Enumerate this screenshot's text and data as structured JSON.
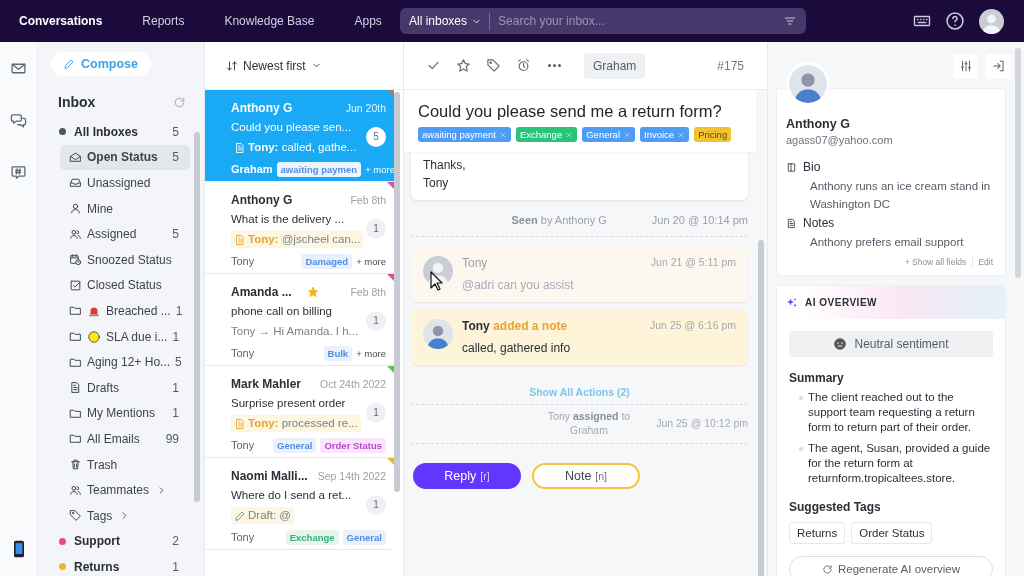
{
  "top_nav": {
    "items": [
      {
        "label": "Conversations",
        "selected": true
      },
      {
        "label": "Reports",
        "selected": false
      },
      {
        "label": "Knowledge Base",
        "selected": false
      },
      {
        "label": "Apps",
        "selected": false
      }
    ],
    "search": {
      "scope": "All inboxes",
      "placeholder": "Search your inbox..."
    }
  },
  "sidebar": {
    "compose": "Compose",
    "title": "Inbox",
    "items": [
      {
        "label": "All Inboxes",
        "count": "5",
        "color": "#4a5468",
        "selected": false,
        "children": [
          {
            "kind": "envelope",
            "label": "Open Status",
            "count": "5",
            "selected": true
          },
          {
            "kind": "tray",
            "label": "Unassigned",
            "selected": false
          },
          {
            "kind": "person",
            "label": "Mine",
            "selected": false
          },
          {
            "kind": "people",
            "label": "Assigned",
            "count": "5",
            "selected": false
          },
          {
            "kind": "calendar",
            "label": "Snoozed Status",
            "selected": false
          },
          {
            "kind": "checkbox",
            "label": "Closed Status",
            "selected": false
          },
          {
            "kind": "siren",
            "label": "Breached ...",
            "count": "1",
            "selected": false
          },
          {
            "kind": "dot",
            "label": "SLA due i...",
            "count": "1",
            "selected": false
          },
          {
            "kind": "folder",
            "label": "Aging 12+ Ho...",
            "count": "5",
            "selected": false
          },
          {
            "kind": "document",
            "label": "Drafts",
            "count": "1",
            "selected": false
          },
          {
            "kind": "folder",
            "label": "My Mentions",
            "count": "1",
            "selected": false
          },
          {
            "kind": "folder",
            "label": "All Emails",
            "count": "99",
            "selected": false
          },
          {
            "kind": "trash",
            "label": "Trash",
            "selected": false
          },
          {
            "kind": "team",
            "label": "Teammates",
            "selected": false
          },
          {
            "kind": "tags",
            "label": "Tags",
            "selected": false
          }
        ]
      },
      {
        "label": "Support",
        "count": "2",
        "color": "#e8479a",
        "selected": false
      },
      {
        "label": "Returns",
        "count": "1",
        "color": "#f0b429",
        "selected": false
      }
    ]
  },
  "conversations": {
    "sort": "Newest first",
    "items": [
      {
        "name": "Anthony G",
        "starred": false,
        "date": "Jun 20th",
        "subject": "Could you please sen...",
        "preview": {
          "kind": "note",
          "text": "**Tony:** called, gathe..."
        },
        "count": "5",
        "assignee": "Graham",
        "tags": [
          {
            "label": "awaiting paymen",
            "color": "#4f8fe8"
          }
        ],
        "more": "+ more",
        "color": "#a08270",
        "selected": true
      },
      {
        "name": "Anthony G",
        "starred": false,
        "date": "Feb 8th",
        "subject": "What is the delivery ...",
        "preview": {
          "kind": "note",
          "text": "**Tony:** @jscheel can..."
        },
        "count": "1",
        "assignee": "Tony",
        "tags": [
          {
            "label": "Damaged",
            "color": "#4f8fe8"
          }
        ],
        "more": "+ more",
        "color": "#e8479a",
        "selected": false
      },
      {
        "name": "Amanda ...",
        "starred": true,
        "date": "Feb 8th",
        "subject": "phone call on billing",
        "preview": {
          "kind": "reply",
          "text": "Tony → Hi Amanda.  I h..."
        },
        "count": "1",
        "assignee": "Tony",
        "tags": [
          {
            "label": "Bulk",
            "color": "#4f8fe8"
          }
        ],
        "more": "+ more",
        "color": "#e8479a",
        "selected": false
      },
      {
        "name": "Mark Mahler",
        "starred": false,
        "date": "Oct 24th 2022",
        "subject": "Surprise present order",
        "preview": {
          "kind": "note",
          "text": "**Tony:** processed re..."
        },
        "count": "1",
        "assignee": "Tony",
        "tags": [
          {
            "label": "General",
            "color": "#4f8fe8"
          },
          {
            "label": "Order Status",
            "color": "#c23fd6"
          }
        ],
        "color": "#5cc93a",
        "selected": false
      },
      {
        "name": "Naomi Malli...",
        "starred": false,
        "date": "Sep 14th 2022",
        "subject": "Where do I send a ret...",
        "preview": {
          "kind": "draft",
          "text": "Draft: @"
        },
        "count": "1",
        "assignee": "Tony",
        "tags": [
          {
            "label": "Exchange",
            "color": "#2fb37a"
          },
          {
            "label": "General",
            "color": "#4f8fe8"
          }
        ],
        "color": "#f0b429",
        "selected": false
      }
    ]
  },
  "detail": {
    "assignee": "Graham",
    "number": "#175",
    "title": "Could you please send me a return form?",
    "tags": [
      {
        "label": "awaiting payment",
        "color": "#4f9cf5",
        "removable": true
      },
      {
        "label": "Exchange",
        "color": "#27c47a",
        "removable": true
      },
      {
        "label": "General",
        "color": "#4f9cf5",
        "removable": true
      },
      {
        "label": "Invoice",
        "color": "#4f9cf5",
        "removable": true
      },
      {
        "label": "Pricing",
        "color": "#f2c230",
        "removable": false
      }
    ],
    "timeline": [
      {
        "kind": "message",
        "lines": [
          "Thanks,",
          "Tony"
        ]
      },
      {
        "kind": "seen",
        "text": "**Seen** by Anthony G",
        "time": "Jun 20 @ 10:14 pm"
      },
      {
        "kind": "note",
        "author": "Tony",
        "body": "@adri can you assist",
        "time": "Jun 21 @ 5:11 pm",
        "faded": true
      },
      {
        "kind": "note",
        "author": "Tony",
        "action": "added a note",
        "body": "called, gathered info",
        "time": "Jun 25 @ 6:16 pm",
        "faded": false
      },
      {
        "kind": "link",
        "text": "Show All Actions (2)"
      },
      {
        "kind": "event",
        "text": "Tony **assigned** to Graham",
        "time": "Jun 25 @ 10:12 pm"
      }
    ],
    "buttons": [
      {
        "kind": "reply",
        "label": "Reply",
        "key": "[r]"
      },
      {
        "kind": "note",
        "label": "Note",
        "key": "[n]"
      }
    ]
  },
  "contact": {
    "name": "Anthony G",
    "email": "agass07@yahoo.com",
    "fields": [
      {
        "kind": "bio",
        "label": "Bio",
        "value": "Anthony runs an ice cream stand in Washington DC"
      },
      {
        "kind": "notes",
        "label": "Notes",
        "value": "Anthony prefers email support"
      }
    ],
    "show_all": "+ Show all fields",
    "edit": "Edit"
  },
  "ai_overview": {
    "title": "AI OVERVIEW",
    "sentiment": "Neutral sentiment",
    "summary_title": "Summary",
    "summary": [
      "The client reached out to the support team requesting a return form to return part of their order.",
      "The agent, Susan, provided a guide for the return form at returnform.tropicaltees.store."
    ],
    "tags_title": "Suggested Tags",
    "tags": [
      "Returns",
      "Order Status"
    ],
    "regenerate": "Regenerate AI overview"
  }
}
